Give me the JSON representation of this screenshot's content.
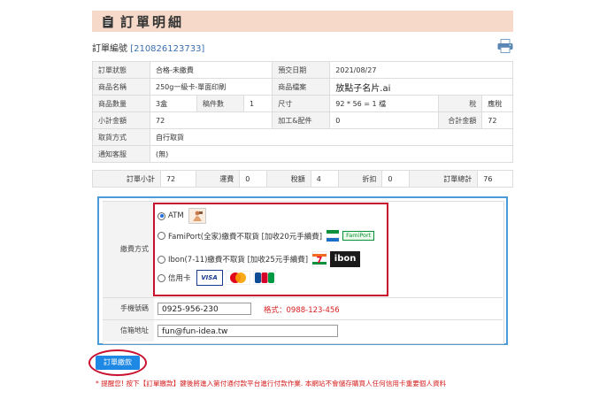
{
  "header": {
    "title": "訂單明細"
  },
  "order": {
    "label": "訂單編號",
    "number": "[210826123733]"
  },
  "info": {
    "status_label": "訂單狀態",
    "status_value": "合格-未繳費",
    "date_label": "預交日期",
    "date_value": "2021/08/27",
    "product_label": "商品名稱",
    "product_value": "250g一級卡-單面印刷",
    "file_label": "商品檔案",
    "file_value": "放點子名片.ai",
    "qty_label": "商品數量",
    "qty_value": "3盒",
    "count_label": "稿件數",
    "count_value": "1",
    "size_label": "尺寸",
    "size_value": "92 * 56 = 1 檔",
    "tax_label": "稅",
    "tax_value": "應稅",
    "subtotal_label": "小計金額",
    "subtotal_value": "72",
    "process_label": "加工&配件",
    "process_value": "0",
    "total_label": "合計金額",
    "total_value": "72",
    "pickup_label": "取貨方式",
    "pickup_value": "自行取貨",
    "notify_label": "通知客服",
    "notify_value": "(無)"
  },
  "summary": {
    "sub_label": "訂單小計",
    "sub_value": "72",
    "ship_label": "運費",
    "ship_value": "0",
    "tax_label": "稅額",
    "tax_value": "4",
    "disc_label": "折扣",
    "disc_value": "0",
    "total_label": "訂單總計",
    "total_value": "76"
  },
  "payment": {
    "label": "繳費方式",
    "atm": "ATM",
    "famiport": "FamiPort(全家)繳費不取貨 [加收20元手續費]",
    "famiport_logo": "FamiPort",
    "ibon": "Ibon(7-11)繳費不取貨 [加收25元手續費]",
    "ibon_logo": "ibon",
    "card": "信用卡",
    "visa": "VISA",
    "master": "MasterCard",
    "jcb": "JCB"
  },
  "phone": {
    "label": "手機號碼",
    "value": "0925-956-230",
    "hint": "格式：0988-123-456"
  },
  "email": {
    "label": "信箱地址",
    "value": "fun@fun-idea.tw"
  },
  "submit_label": "訂單繳款",
  "notice": "* 提醒您! 按下【訂單繳款】鍵後將進入第付通付款平台進行付款作業. 本網站不會儲存購買人任何信用卡重要個人資料"
}
